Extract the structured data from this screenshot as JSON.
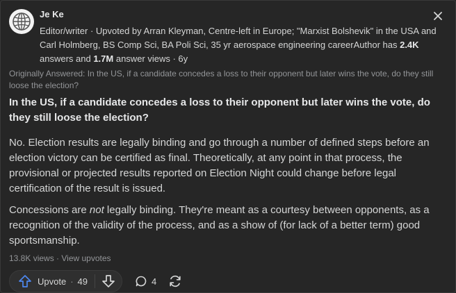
{
  "author": {
    "name": "Je Ke",
    "cred_prefix": "Editor/writer · Upvoted by Arran Kleyman, Centre-left in Europe; \"Marxist Bolshevik\" in the USA and Carl Holmberg, BS Comp Sci, BA Poli Sci, 35 yr aerospace engineering careerAuthor has ",
    "answers_count": "2.4K",
    "answers_word": " answers and ",
    "views_count": "1.7M",
    "views_suffix": " answer views · 6y"
  },
  "originally_answered": "Originally Answered: In the US, if a candidate concedes a loss to their opponent but later wins the vote, do they still loose the election?",
  "question": "In the US, if a candidate concedes a loss to their opponent but later wins the vote, do they still loose the election?",
  "answer": {
    "p1": "No. Election results are legally binding and go through a number of defined steps before an election victory can be certified as final. Theoretically, at any point in that process, the provisional or projected results reported on Election Night could change before legal certification of the result is issued.",
    "p2_before": "Concessions are ",
    "p2_em": "not",
    "p2_after": " legally binding. They're meant as a courtesy between opponents, as a recognition of the validity of the process, and as a show of (for lack of a better term) good sportsmanship."
  },
  "meta": {
    "views": "13.8K views",
    "sep": " · ",
    "view_upvotes": "View upvotes"
  },
  "actions": {
    "upvote_label": "Upvote",
    "upvote_sep": "·",
    "upvote_count": "49",
    "comment_count": "4"
  },
  "icons": {
    "avatar": "globe-icon",
    "close": "close-icon",
    "upvote": "arrow-up-icon",
    "downvote": "arrow-down-icon",
    "comment": "comment-bubble-icon",
    "share": "share-refresh-icon"
  },
  "colors": {
    "background": "#262626",
    "text": "#d5d6d6",
    "muted": "#939598",
    "upvote_icon": "#4d88f0"
  }
}
